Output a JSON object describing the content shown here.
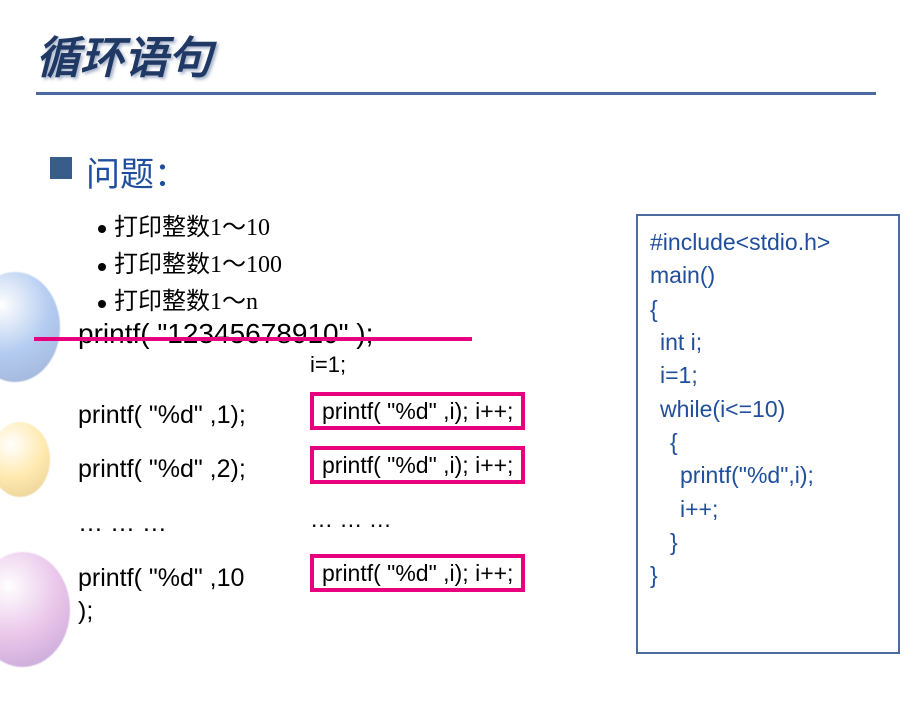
{
  "title": "循环语句",
  "problem_label": "问题：",
  "bullets": {
    "b1": "打印整数1～10",
    "b2": "打印整数1～100",
    "b3": "打印整数1～n"
  },
  "struck_line": "printf( \"12345678910\" );",
  "ivar": "i=1;",
  "left_col": {
    "l1": "printf( \"%d\" ,1);",
    "l2": "printf( \"%d\" ,2);",
    "l3": "… … …",
    "l4a": "printf( \"%d\" ,10",
    "l4b": ");"
  },
  "right_col": {
    "r1": "printf( \"%d\" ,i); i++;",
    "r2": "printf( \"%d\" ,i); i++;",
    "r3": "… … …",
    "r4": "printf( \"%d\" ,i); i++;"
  },
  "code": {
    "c1": "#include<stdio.h>",
    "c2": "main()",
    "c3": "{",
    "c4": "int i;",
    "c5": "i=1;",
    "c6": "while(i<=10)",
    "c7": "{",
    "c8": "printf(\"%d\",i);",
    "c9": "i++;",
    "c10": "}",
    "c11": "}"
  }
}
